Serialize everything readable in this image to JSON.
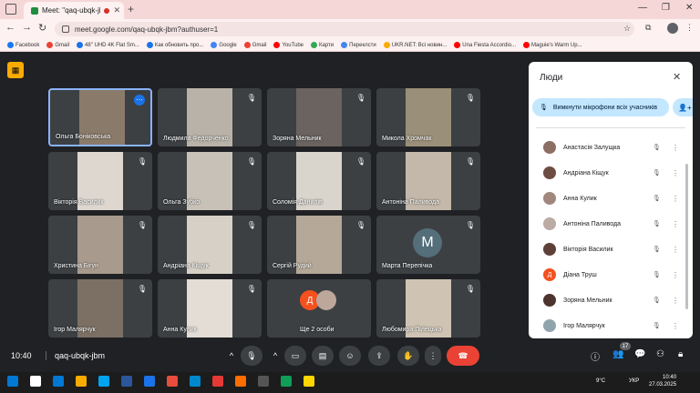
{
  "browser": {
    "tab_title": "Meet: \"qaq-ubqk-jbm\"",
    "url": "meet.google.com/qaq-ubqk-jbm?authuser=1",
    "bookmarks": [
      {
        "label": "Facebook",
        "color": "#1877f2"
      },
      {
        "label": "Gmail",
        "color": "#ea4335"
      },
      {
        "label": "48\" UHD 4K Flat Sm...",
        "color": "#1a73e8"
      },
      {
        "label": "Как обновить про...",
        "color": "#1a73e8"
      },
      {
        "label": "Google",
        "color": "#4285f4"
      },
      {
        "label": "Gmail",
        "color": "#ea4335"
      },
      {
        "label": "YouTube",
        "color": "#ff0000"
      },
      {
        "label": "Карти",
        "color": "#34a853"
      },
      {
        "label": "Переклсти",
        "color": "#4285f4"
      },
      {
        "label": "UKR.NET: Всі новин...",
        "color": "#f9ab00"
      },
      {
        "label": "Una Fiesta Accordio...",
        "color": "#ff0000"
      },
      {
        "label": "Maguie's Warm Up...",
        "color": "#ff0000"
      }
    ]
  },
  "meet": {
    "time": "10:40",
    "meeting_code": "qaq-ubqk-jbm",
    "participant_count": "17",
    "tiles": [
      {
        "name": "Ольга Боніковська",
        "bg": "#8a7a6a"
      },
      {
        "name": "Людмила Федорченко",
        "bg": "#b9b2a9"
      },
      {
        "name": "Зоряна Мельник",
        "bg": "#6a6360"
      },
      {
        "name": "Микола Хромчак",
        "bg": "#9a8f78"
      },
      {
        "name": "Вікторія Василик",
        "bg": "#ddd7d0"
      },
      {
        "name": "Ольга Зубко",
        "bg": "#c8c1b8"
      },
      {
        "name": "Соломія Данилів",
        "bg": "#d9d4cc"
      },
      {
        "name": "Антоніна Паливода",
        "bg": "#c4b8aa"
      },
      {
        "name": "Христина Бігун",
        "bg": "#a89a8c"
      },
      {
        "name": "Андріана Кіщук",
        "bg": "#d6d0c6"
      },
      {
        "name": "Сергій Рудий",
        "bg": "#b5a898"
      },
      {
        "name": "Марта Перепічка",
        "avatar": "M",
        "avatar_color": "#546e7a"
      },
      {
        "name": "Ігор Малярчук",
        "bg": "#7c7065"
      },
      {
        "name": "Анна Кулик",
        "bg": "#e3ddd6"
      },
      {
        "name": "Ще 2 особи",
        "avatar": "Д",
        "avatar_color": "#f4511e"
      },
      {
        "name": "Любомира Пілецька",
        "bg": "#cfc3b3"
      }
    ]
  },
  "people": {
    "title": "Люди",
    "mute_all": "Вимкнути мікрофони всіх учасників",
    "list": [
      {
        "name": "Анастасія Залущка",
        "color": "#8d6e63"
      },
      {
        "name": "Андріана Кіщук",
        "color": "#6d4c41"
      },
      {
        "name": "Анна Кулик",
        "color": "#a1887f"
      },
      {
        "name": "Антоніна Паливода",
        "color": "#bcaaa4"
      },
      {
        "name": "Вікторія Василик",
        "color": "#5d4037"
      },
      {
        "name": "Діана Труш",
        "color": "#f4511e",
        "initial": "Д"
      },
      {
        "name": "Зоряна Мельник",
        "color": "#4e342e"
      },
      {
        "name": "Ігор Малярчук",
        "color": "#90a4ae"
      }
    ]
  },
  "taskbar": {
    "time": "10:40",
    "date": "27.03.2025",
    "lang": "УКР",
    "temp": "9°С"
  }
}
